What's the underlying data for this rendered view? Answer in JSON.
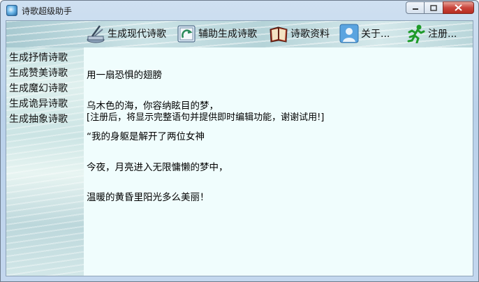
{
  "window": {
    "title": "诗歌超级助手"
  },
  "toolbar": {
    "modern": "生成现代诗歌",
    "assist": "辅助生成诗歌",
    "library": "诗歌资料",
    "about": "关于...",
    "register": "注册..."
  },
  "sidebar": {
    "items": [
      {
        "label": "生成抒情诗歌"
      },
      {
        "label": "生成赞美诗歌"
      },
      {
        "label": "生成魔幻诗歌"
      },
      {
        "label": "生成诡异诗歌"
      },
      {
        "label": "生成抽象诗歌"
      }
    ]
  },
  "content": {
    "poem": [
      "用一扇恐惧的翅膀",
      "乌木色的海，你容纳眩目的梦，",
      "“我的身躯是解开了两位女神",
      "今夜，月亮进入无限慵懒的梦中，",
      "温暖的黄昏里阳光多么美丽！"
    ],
    "notice": "[注册后，将显示完整语句并提供即时编辑功能，谢谢试用!]"
  },
  "colors": {
    "content_bg": "#f0fdfd",
    "close_red": "#c9463d"
  }
}
